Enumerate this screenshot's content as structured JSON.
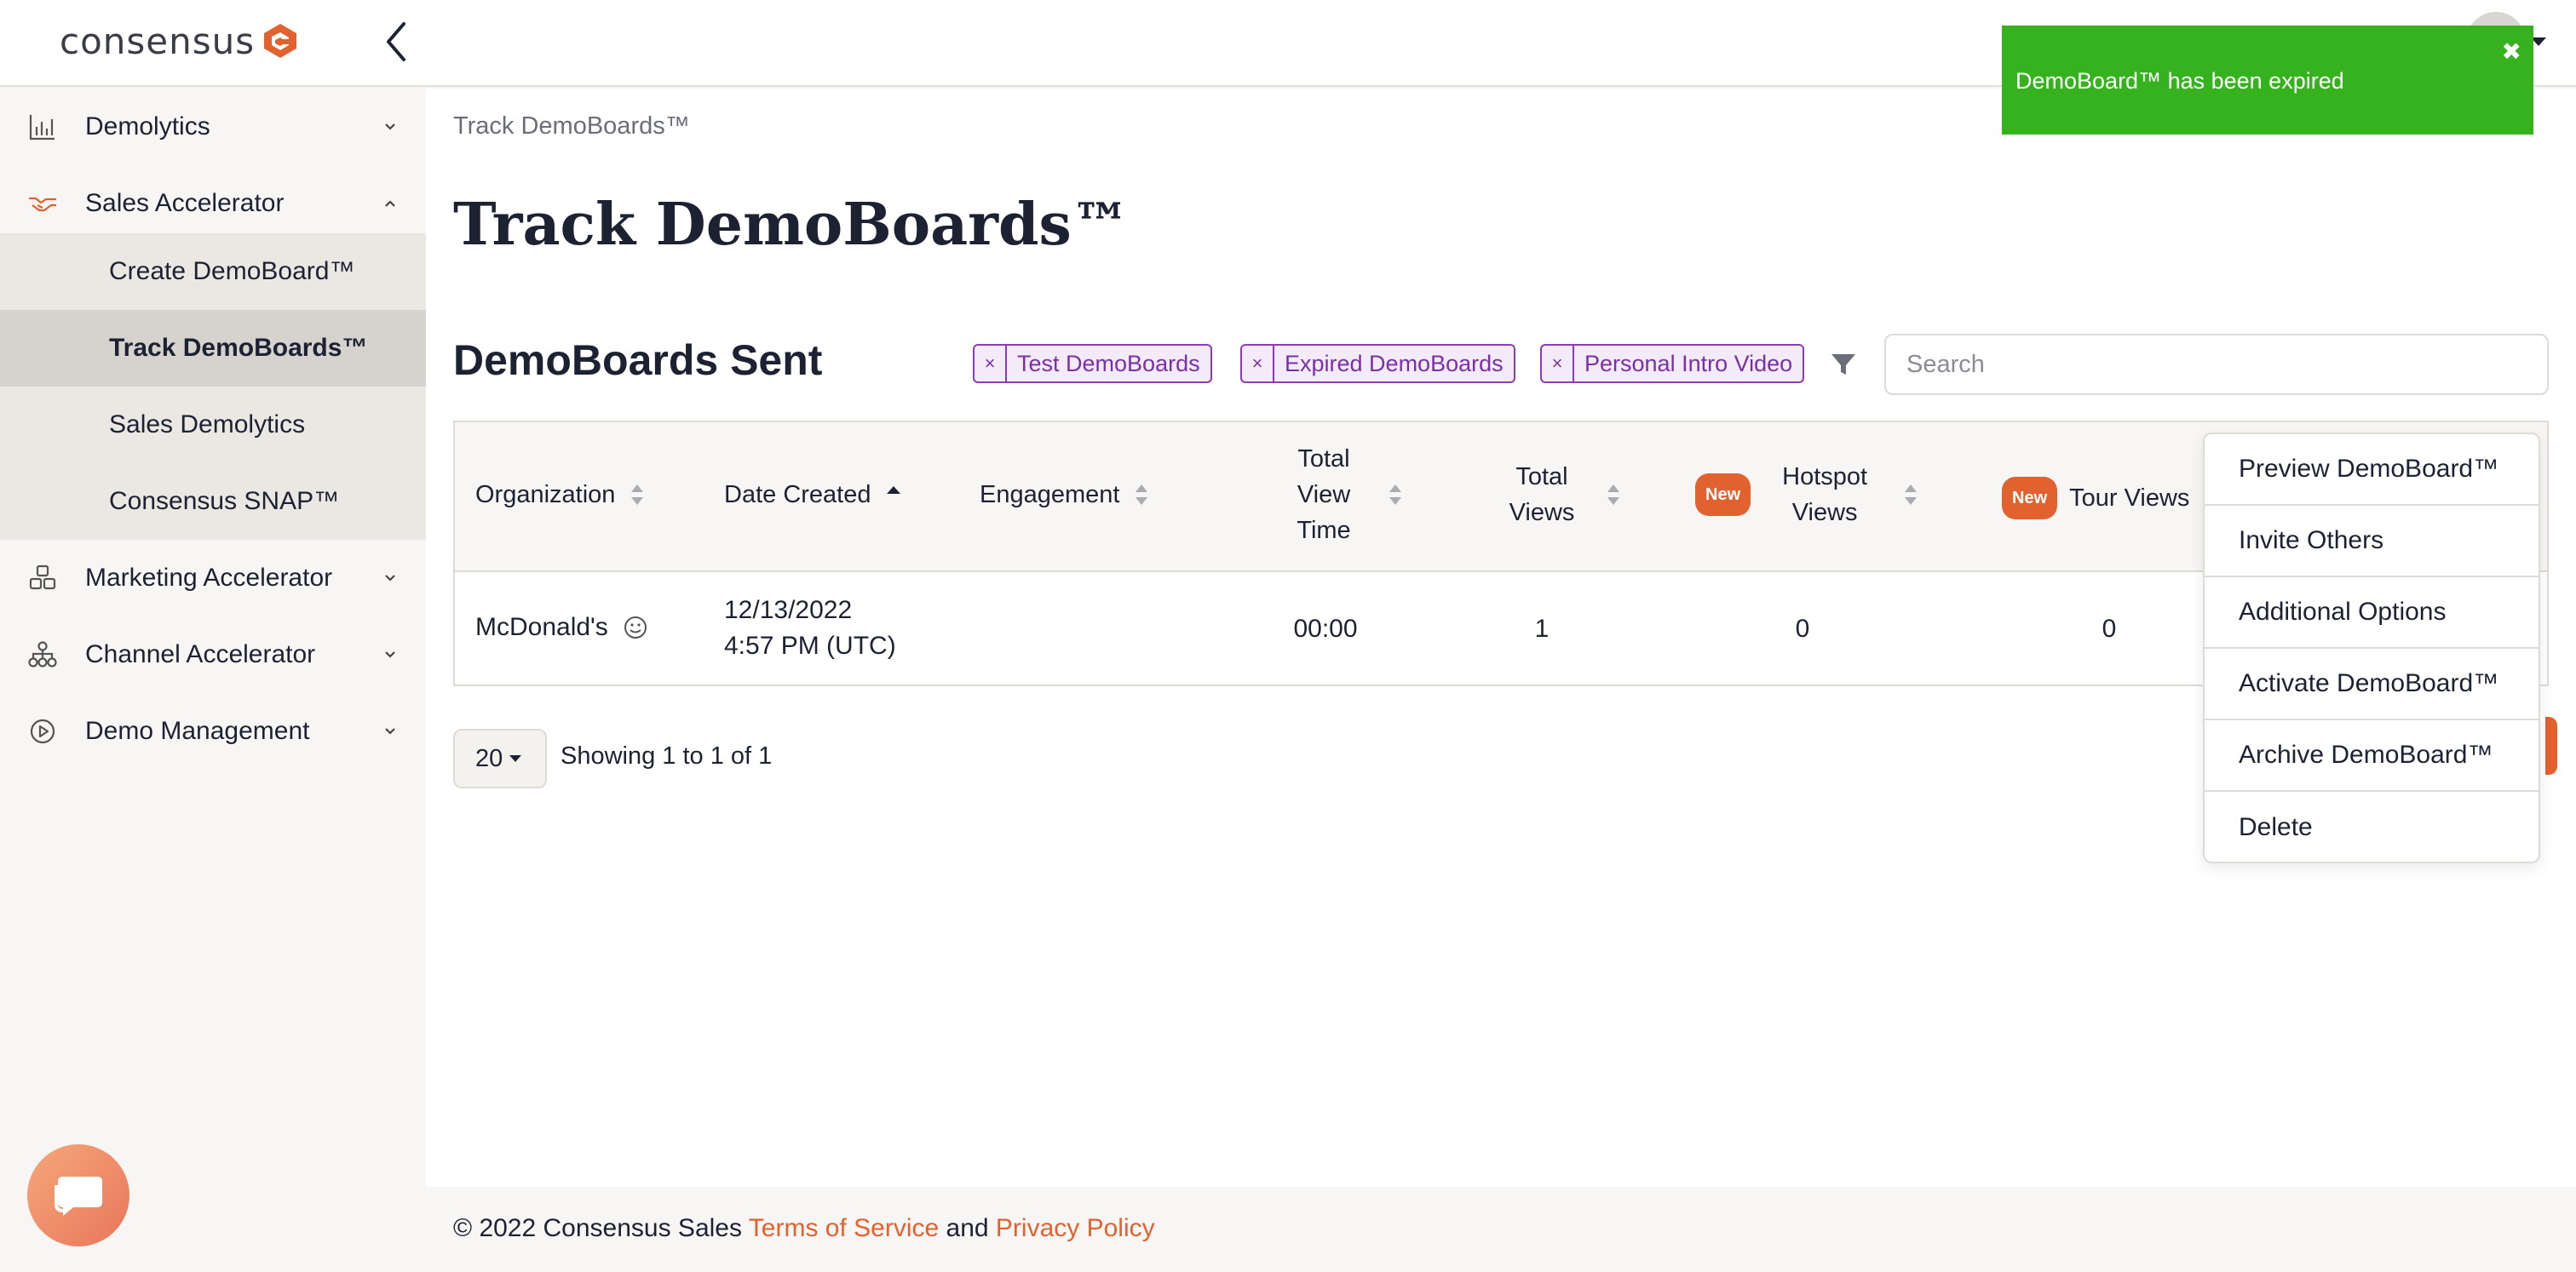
{
  "app": {
    "logo_text": "consensus",
    "brand_color": "#e2622f"
  },
  "toast": {
    "message": "DemoBoard™ has been expired",
    "close_icon": "✖",
    "color": "#37b21f"
  },
  "sidebar": {
    "items": [
      {
        "label": "Demolytics",
        "icon": "bar-chart-icon"
      },
      {
        "label": "Sales Accelerator",
        "icon": "handshake-icon"
      },
      {
        "label": "Marketing Accelerator",
        "icon": "boxes-icon"
      },
      {
        "label": "Channel Accelerator",
        "icon": "network-icon"
      },
      {
        "label": "Demo Management",
        "icon": "play-circle-icon"
      }
    ],
    "sub_items": [
      {
        "label": "Create DemoBoard™"
      },
      {
        "label": "Track DemoBoards™"
      },
      {
        "label": "Sales Demolytics"
      },
      {
        "label": "Consensus SNAP™"
      }
    ]
  },
  "main": {
    "breadcrumb": "Track DemoBoards™",
    "title": "Track DemoBoards™",
    "section_title": "DemoBoards Sent",
    "filters": [
      {
        "label": "Test DemoBoards",
        "remove": "×"
      },
      {
        "label": "Expired DemoBoards",
        "remove": "×"
      },
      {
        "label": "Personal Intro Video",
        "remove": "×"
      }
    ],
    "search_placeholder": "Search"
  },
  "table": {
    "headers": {
      "organization": "Organization",
      "date_created": "Date Created",
      "engagement": "Engagement",
      "total_view_time_1": "Total",
      "total_view_time_2": "View",
      "total_view_time_3": "Time",
      "total_views_1": "Total",
      "total_views_2": "Views",
      "hotspot_badge": "New",
      "hotspot_views_1": "Hotspot",
      "hotspot_views_2": "Views",
      "tour_badge": "New",
      "tour_views": "Tour Views"
    },
    "rows": [
      {
        "organization": "McDonald's",
        "date_line1": "12/13/2022",
        "date_line2": "4:57 PM (UTC)",
        "total_view_time": "00:00",
        "total_views": "1",
        "hotspot_views": "0",
        "tour_views": "0"
      }
    ]
  },
  "pager": {
    "page_size": "20",
    "showing": "Showing 1 to 1 of 1"
  },
  "row_menu": {
    "items": [
      "Preview DemoBoard™",
      "Invite Others",
      "Additional Options",
      "Activate DemoBoard™",
      "Archive DemoBoard™",
      "Delete"
    ]
  },
  "footer": {
    "copyright": "© 2022 Consensus Sales ",
    "terms": "Terms of Service",
    "and": " and ",
    "privacy": "Privacy Policy"
  }
}
